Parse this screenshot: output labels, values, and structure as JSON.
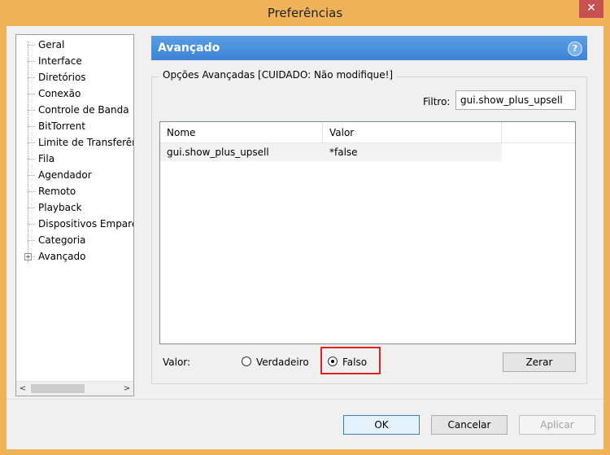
{
  "window": {
    "title": "Preferências",
    "close_glyph": "✕"
  },
  "tree": {
    "items": [
      {
        "label": "Geral"
      },
      {
        "label": "Interface"
      },
      {
        "label": "Diretórios"
      },
      {
        "label": "Conexão"
      },
      {
        "label": "Controle de Banda"
      },
      {
        "label": "BitTorrent"
      },
      {
        "label": "Limite de Transferência"
      },
      {
        "label": "Fila"
      },
      {
        "label": "Agendador"
      },
      {
        "label": "Remoto"
      },
      {
        "label": "Playback"
      },
      {
        "label": "Dispositivos Emparelhados"
      },
      {
        "label": "Categoria"
      },
      {
        "label": "Avançado"
      }
    ],
    "expander_glyph": "+",
    "scroll_left": "<",
    "scroll_right": ">"
  },
  "panel": {
    "title": "Avançado",
    "help_glyph": "?",
    "group_title": "Opções Avançadas [CUIDADO: Não modifique!]",
    "filter_label": "Filtro:",
    "filter_value": "gui.show_plus_upsell"
  },
  "table": {
    "columns": [
      "Nome",
      "Valor"
    ],
    "rows": [
      {
        "nome": "gui.show_plus_upsell",
        "valor": "*false"
      }
    ]
  },
  "value_editor": {
    "label": "Valor:",
    "option_true": "Verdadeiro",
    "option_false": "Falso",
    "selected": "Falso",
    "reset_button": "Zerar"
  },
  "footer": {
    "ok": "OK",
    "cancel": "Cancelar",
    "apply": "Aplicar"
  },
  "colors": {
    "header": "#3b84d5",
    "highlight": "#e0201c",
    "frame": "#f0b35a"
  }
}
